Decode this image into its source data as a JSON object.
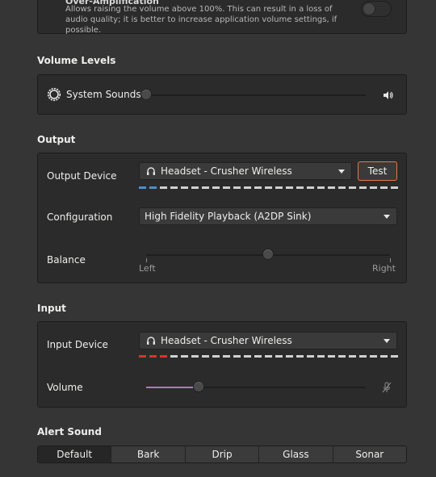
{
  "overamp": {
    "title": "Over-Amplification",
    "description": "Allows raising the volume above 100%. This can result in a loss of audio quality; it is better to increase application volume settings, if possible."
  },
  "volume_levels": {
    "heading": "Volume Levels",
    "system_sounds_label": "System Sounds",
    "system_sounds_level": 0
  },
  "output": {
    "heading": "Output",
    "device_label": "Output Device",
    "device_value": "Headset - Crusher Wireless",
    "test_label": "Test",
    "level_active_segments": 2,
    "level_active_color": "#4a8fd0",
    "configuration_label": "Configuration",
    "configuration_value": "High Fidelity Playback (A2DP Sink)",
    "balance_label": "Balance",
    "balance_value": 0.5,
    "balance_left": "Left",
    "balance_right": "Right"
  },
  "input": {
    "heading": "Input",
    "device_label": "Input Device",
    "device_value": "Headset - Crusher Wireless",
    "level_active_segments": 3,
    "level_active_color": "#e0302b",
    "volume_label": "Volume",
    "volume_level": 0.24,
    "volume_fill_color": "#b574c9"
  },
  "alert_sound": {
    "heading": "Alert Sound",
    "tabs": [
      "Default",
      "Bark",
      "Drip",
      "Glass",
      "Sonar"
    ],
    "selected": "Default"
  },
  "colors": {
    "accent_button_border": "#e07a4a"
  },
  "icons": {
    "system_sounds": "gear-icon",
    "speaker": "speaker-icon",
    "headset": "headset-icon",
    "mic_muted": "microphone-muted-icon"
  }
}
